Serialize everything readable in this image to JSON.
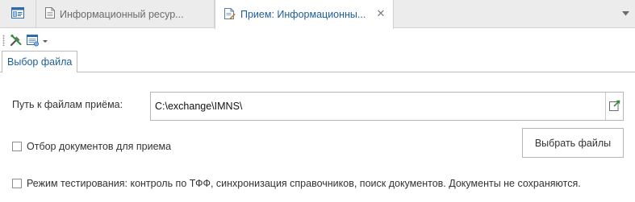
{
  "tabs": [
    {
      "label": "",
      "icon": "window-icon",
      "active": false
    },
    {
      "label": "Информационный ресур...",
      "icon": "document-icon",
      "active": false
    },
    {
      "label": "Прием: Информационны...",
      "icon": "document-edit-icon",
      "active": true
    }
  ],
  "tab_close_glyph": "✕",
  "toolbar": {
    "buttons": [
      {
        "icon": "tools-icon"
      },
      {
        "icon": "document-settings-icon",
        "has_dropdown": true
      }
    ]
  },
  "section_tab": {
    "label": "Выбор файла"
  },
  "form": {
    "path_label": "Путь к файлам приёма:",
    "path_value": "C:\\exchange\\IMNS\\",
    "select_docs_label": "Отбор документов для приема",
    "select_docs_checked": false,
    "select_files_button": "Выбрать файлы",
    "test_mode_label": "Режим тестирования: контроль по ТФФ, синхронизация справочников, поиск документов. Документы не сохраняются.",
    "test_mode_checked": false
  },
  "colors": {
    "accent": "#1c5d9a",
    "tabstrip_bg": "#ececec",
    "border": "#b5b5b5"
  }
}
